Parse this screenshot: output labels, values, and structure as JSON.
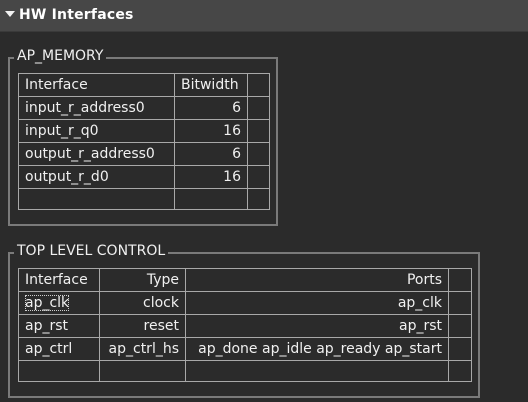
{
  "header": {
    "title": "HW Interfaces"
  },
  "ap_memory": {
    "title": "AP_MEMORY",
    "columns": [
      "Interface",
      "Bitwidth"
    ],
    "rows": [
      {
        "interface": "input_r_address0",
        "bitwidth": "6"
      },
      {
        "interface": "input_r_q0",
        "bitwidth": "16"
      },
      {
        "interface": "output_r_address0",
        "bitwidth": "6"
      },
      {
        "interface": "output_r_d0",
        "bitwidth": "16"
      }
    ]
  },
  "top_level": {
    "title": "TOP LEVEL CONTROL",
    "columns": [
      "Interface",
      "Type",
      "Ports"
    ],
    "rows": [
      {
        "interface": "ap_clk",
        "type": "clock",
        "ports": "ap_clk"
      },
      {
        "interface": "ap_rst",
        "type": "reset",
        "ports": "ap_rst"
      },
      {
        "interface": "ap_ctrl",
        "type": "ap_ctrl_hs",
        "ports": "ap_done ap_idle ap_ready ap_start"
      }
    ]
  }
}
